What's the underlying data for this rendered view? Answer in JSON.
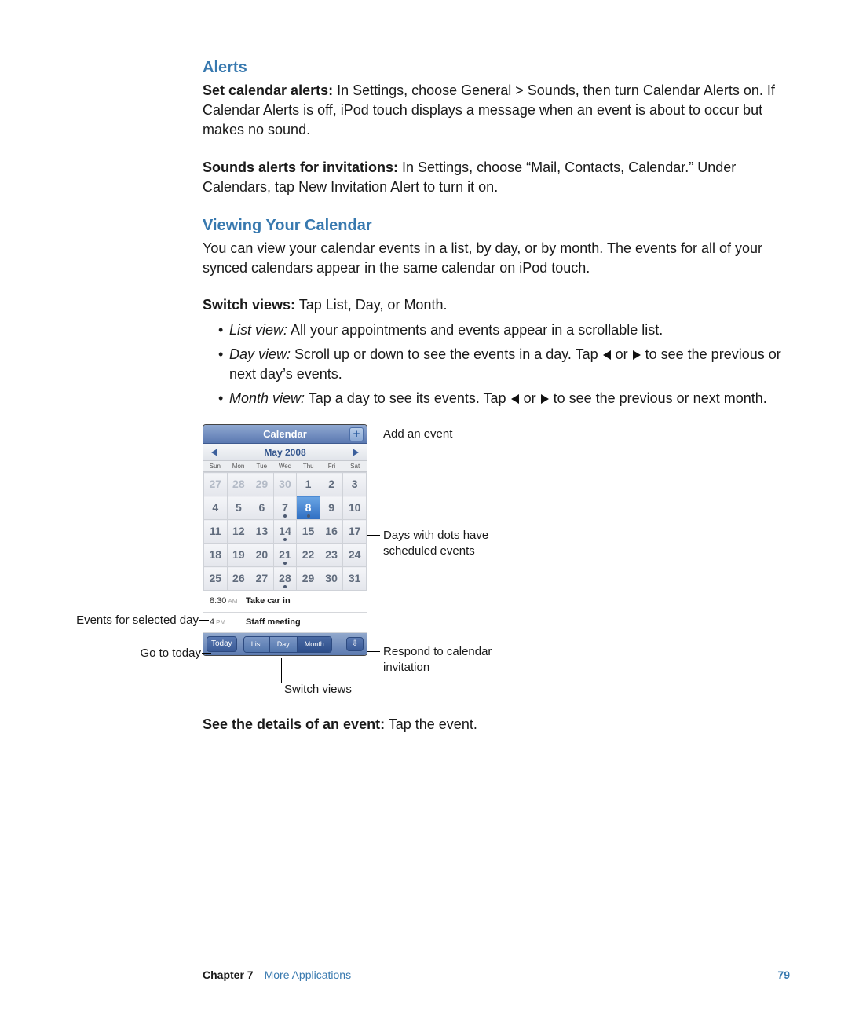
{
  "sections": {
    "alerts": {
      "heading": "Alerts",
      "p1_lead": "Set calendar alerts:",
      "p1_rest": "  In Settings, choose General > Sounds, then turn Calendar Alerts on. If Calendar Alerts is off, iPod touch displays a message when an event is about to occur but makes no sound.",
      "p2_lead": "Sounds alerts for invitations:",
      "p2_rest": "  In Settings, choose “Mail, Contacts, Calendar.” Under Calendars, tap New Invitation Alert to turn it on."
    },
    "viewing": {
      "heading": "Viewing Your Calendar",
      "p1": "You can view your calendar events in a list, by day, or by month. The events for all of your synced calendars appear in the same calendar on iPod touch.",
      "switch_lead": "Switch views:",
      "switch_rest": "  Tap List, Day, or Month.",
      "li1_lead": "List view:",
      "li1_rest": " All your appointments and events appear in a scrollable list.",
      "li2_lead": "Day view:",
      "li2_a": "  Scroll up or down to see the events in a day. Tap ",
      "li2_b": " or ",
      "li2_c": " to see the previous or next day’s events.",
      "li3_lead": "Month view:",
      "li3_a": " Tap a day to see its events. Tap ",
      "li3_b": " or ",
      "li3_c": " to see the previous or next month.",
      "see_lead": "See the details of an event:",
      "see_rest": "  Tap the event."
    }
  },
  "phone": {
    "title": "Calendar",
    "add_symbol": "+",
    "month": "May 2008",
    "dow": [
      "Sun",
      "Mon",
      "Tue",
      "Wed",
      "Thu",
      "Fri",
      "Sat"
    ],
    "weeks": [
      [
        {
          "n": "27",
          "o": true
        },
        {
          "n": "28",
          "o": true
        },
        {
          "n": "29",
          "o": true
        },
        {
          "n": "30",
          "o": true
        },
        {
          "n": "1"
        },
        {
          "n": "2"
        },
        {
          "n": "3"
        }
      ],
      [
        {
          "n": "4"
        },
        {
          "n": "5"
        },
        {
          "n": "6"
        },
        {
          "n": "7",
          "d": true
        },
        {
          "n": "8",
          "sel": true,
          "d": true
        },
        {
          "n": "9"
        },
        {
          "n": "10"
        }
      ],
      [
        {
          "n": "11"
        },
        {
          "n": "12"
        },
        {
          "n": "13"
        },
        {
          "n": "14",
          "d": true
        },
        {
          "n": "15"
        },
        {
          "n": "16"
        },
        {
          "n": "17"
        }
      ],
      [
        {
          "n": "18"
        },
        {
          "n": "19"
        },
        {
          "n": "20"
        },
        {
          "n": "21",
          "d": true
        },
        {
          "n": "22"
        },
        {
          "n": "23"
        },
        {
          "n": "24"
        }
      ],
      [
        {
          "n": "25"
        },
        {
          "n": "26"
        },
        {
          "n": "27"
        },
        {
          "n": "28",
          "d": true
        },
        {
          "n": "29"
        },
        {
          "n": "30"
        },
        {
          "n": "31"
        }
      ]
    ],
    "events": [
      {
        "time": "8:30",
        "ampm": "AM",
        "title": "Take car in"
      },
      {
        "time": "4",
        "ampm": "PM",
        "title": "Staff meeting"
      }
    ],
    "today": "Today",
    "seg": [
      "List",
      "Day",
      "Month"
    ],
    "inbox_glyph": "⇩"
  },
  "callouts": {
    "add": "Add an event",
    "dots": "Days with dots have scheduled events",
    "events": "Events for selected day",
    "today": "Go to today",
    "respond": "Respond to calendar invitation",
    "switch": "Switch views"
  },
  "footer": {
    "chapter_label": "Chapter 7",
    "chapter_name": "More Applications",
    "page": "79"
  }
}
